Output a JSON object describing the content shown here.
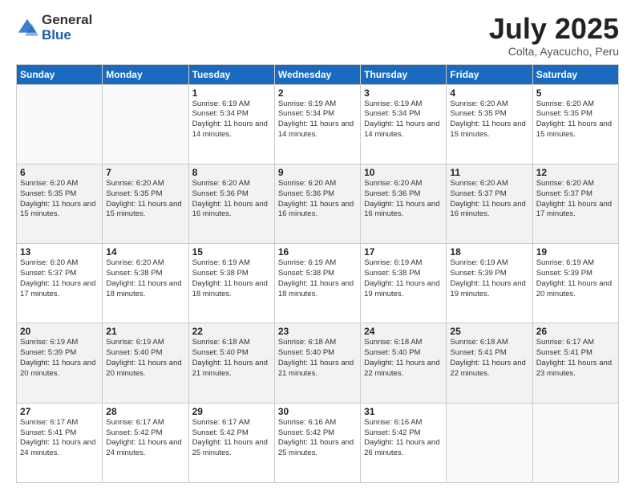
{
  "logo": {
    "general": "General",
    "blue": "Blue"
  },
  "header": {
    "month": "July 2025",
    "location": "Colta, Ayacucho, Peru"
  },
  "weekdays": [
    "Sunday",
    "Monday",
    "Tuesday",
    "Wednesday",
    "Thursday",
    "Friday",
    "Saturday"
  ],
  "weeks": [
    [
      {
        "day": "",
        "info": ""
      },
      {
        "day": "",
        "info": ""
      },
      {
        "day": "1",
        "info": "Sunrise: 6:19 AM\nSunset: 5:34 PM\nDaylight: 11 hours and 14 minutes."
      },
      {
        "day": "2",
        "info": "Sunrise: 6:19 AM\nSunset: 5:34 PM\nDaylight: 11 hours and 14 minutes."
      },
      {
        "day": "3",
        "info": "Sunrise: 6:19 AM\nSunset: 5:34 PM\nDaylight: 11 hours and 14 minutes."
      },
      {
        "day": "4",
        "info": "Sunrise: 6:20 AM\nSunset: 5:35 PM\nDaylight: 11 hours and 15 minutes."
      },
      {
        "day": "5",
        "info": "Sunrise: 6:20 AM\nSunset: 5:35 PM\nDaylight: 11 hours and 15 minutes."
      }
    ],
    [
      {
        "day": "6",
        "info": "Sunrise: 6:20 AM\nSunset: 5:35 PM\nDaylight: 11 hours and 15 minutes."
      },
      {
        "day": "7",
        "info": "Sunrise: 6:20 AM\nSunset: 5:35 PM\nDaylight: 11 hours and 15 minutes."
      },
      {
        "day": "8",
        "info": "Sunrise: 6:20 AM\nSunset: 5:36 PM\nDaylight: 11 hours and 16 minutes."
      },
      {
        "day": "9",
        "info": "Sunrise: 6:20 AM\nSunset: 5:36 PM\nDaylight: 11 hours and 16 minutes."
      },
      {
        "day": "10",
        "info": "Sunrise: 6:20 AM\nSunset: 5:36 PM\nDaylight: 11 hours and 16 minutes."
      },
      {
        "day": "11",
        "info": "Sunrise: 6:20 AM\nSunset: 5:37 PM\nDaylight: 11 hours and 16 minutes."
      },
      {
        "day": "12",
        "info": "Sunrise: 6:20 AM\nSunset: 5:37 PM\nDaylight: 11 hours and 17 minutes."
      }
    ],
    [
      {
        "day": "13",
        "info": "Sunrise: 6:20 AM\nSunset: 5:37 PM\nDaylight: 11 hours and 17 minutes."
      },
      {
        "day": "14",
        "info": "Sunrise: 6:20 AM\nSunset: 5:38 PM\nDaylight: 11 hours and 18 minutes."
      },
      {
        "day": "15",
        "info": "Sunrise: 6:19 AM\nSunset: 5:38 PM\nDaylight: 11 hours and 18 minutes."
      },
      {
        "day": "16",
        "info": "Sunrise: 6:19 AM\nSunset: 5:38 PM\nDaylight: 11 hours and 18 minutes."
      },
      {
        "day": "17",
        "info": "Sunrise: 6:19 AM\nSunset: 5:38 PM\nDaylight: 11 hours and 19 minutes."
      },
      {
        "day": "18",
        "info": "Sunrise: 6:19 AM\nSunset: 5:39 PM\nDaylight: 11 hours and 19 minutes."
      },
      {
        "day": "19",
        "info": "Sunrise: 6:19 AM\nSunset: 5:39 PM\nDaylight: 11 hours and 20 minutes."
      }
    ],
    [
      {
        "day": "20",
        "info": "Sunrise: 6:19 AM\nSunset: 5:39 PM\nDaylight: 11 hours and 20 minutes."
      },
      {
        "day": "21",
        "info": "Sunrise: 6:19 AM\nSunset: 5:40 PM\nDaylight: 11 hours and 20 minutes."
      },
      {
        "day": "22",
        "info": "Sunrise: 6:18 AM\nSunset: 5:40 PM\nDaylight: 11 hours and 21 minutes."
      },
      {
        "day": "23",
        "info": "Sunrise: 6:18 AM\nSunset: 5:40 PM\nDaylight: 11 hours and 21 minutes."
      },
      {
        "day": "24",
        "info": "Sunrise: 6:18 AM\nSunset: 5:40 PM\nDaylight: 11 hours and 22 minutes."
      },
      {
        "day": "25",
        "info": "Sunrise: 6:18 AM\nSunset: 5:41 PM\nDaylight: 11 hours and 22 minutes."
      },
      {
        "day": "26",
        "info": "Sunrise: 6:17 AM\nSunset: 5:41 PM\nDaylight: 11 hours and 23 minutes."
      }
    ],
    [
      {
        "day": "27",
        "info": "Sunrise: 6:17 AM\nSunset: 5:41 PM\nDaylight: 11 hours and 24 minutes."
      },
      {
        "day": "28",
        "info": "Sunrise: 6:17 AM\nSunset: 5:42 PM\nDaylight: 11 hours and 24 minutes."
      },
      {
        "day": "29",
        "info": "Sunrise: 6:17 AM\nSunset: 5:42 PM\nDaylight: 11 hours and 25 minutes."
      },
      {
        "day": "30",
        "info": "Sunrise: 6:16 AM\nSunset: 5:42 PM\nDaylight: 11 hours and 25 minutes."
      },
      {
        "day": "31",
        "info": "Sunrise: 6:16 AM\nSunset: 5:42 PM\nDaylight: 11 hours and 26 minutes."
      },
      {
        "day": "",
        "info": ""
      },
      {
        "day": "",
        "info": ""
      }
    ]
  ]
}
